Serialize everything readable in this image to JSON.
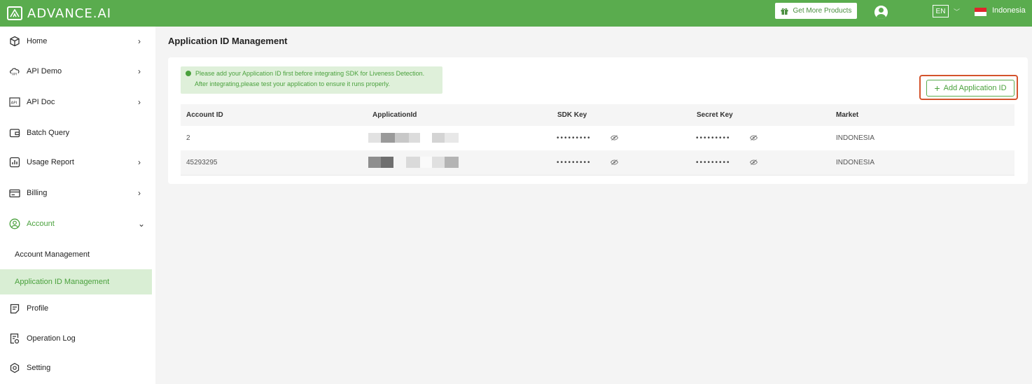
{
  "header": {
    "logo_text": "ADVANCE.AI",
    "get_more_label": "Get More Products",
    "language": "EN",
    "country": "Indonesia",
    "brand_color": "#5aac4e"
  },
  "sidebar": {
    "items": [
      {
        "label": "Home",
        "icon": "box-icon"
      },
      {
        "label": "API Demo",
        "icon": "cloud-api-icon"
      },
      {
        "label": "API Doc",
        "icon": "api-doc-icon"
      },
      {
        "label": "Batch Query",
        "icon": "wallet-icon"
      },
      {
        "label": "Usage Report",
        "icon": "chart-icon"
      },
      {
        "label": "Billing",
        "icon": "card-icon"
      },
      {
        "label": "Account",
        "icon": "user-circle-icon"
      },
      {
        "label": "Profile",
        "icon": "document-icon"
      },
      {
        "label": "Operation Log",
        "icon": "log-icon"
      },
      {
        "label": "Setting",
        "icon": "gear-icon"
      }
    ],
    "account_sub": [
      "Account Management",
      "Application ID Management"
    ]
  },
  "main": {
    "title": "Application ID Management",
    "notice_line1": "Please add your Application ID first before integrating SDK for Liveness Detection.",
    "notice_line2": "After integrating,please test your application to ensure it runs properly.",
    "add_button": "Add Application ID",
    "table": {
      "headers": [
        "Account ID",
        "ApplicationId",
        "SDK Key",
        "Secret Key",
        "Market"
      ],
      "rows": [
        {
          "account_id": "2",
          "sdk_key": "•••••••••",
          "secret_key": "•••••••••",
          "market": "INDONESIA"
        },
        {
          "account_id": "45293295",
          "sdk_key": "•••••••••",
          "secret_key": "•••••••••",
          "market": "INDONESIA"
        }
      ]
    }
  }
}
